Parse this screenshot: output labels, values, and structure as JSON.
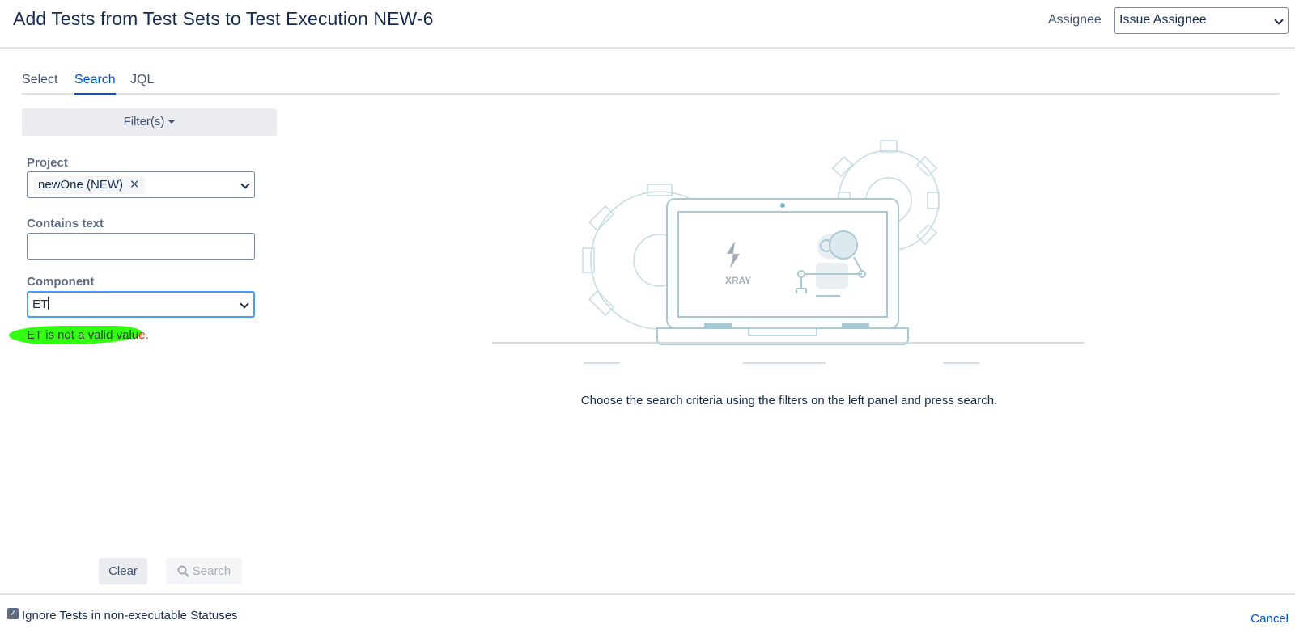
{
  "dialog": {
    "title": "Add Tests from Test Sets to Test Execution NEW-6",
    "assignee_label": "Assignee",
    "assignee_value": "Issue Assignee"
  },
  "tabs": [
    {
      "label": "Select",
      "active": false
    },
    {
      "label": "Search",
      "active": true
    },
    {
      "label": "JQL",
      "active": false
    }
  ],
  "filters": {
    "toggle_label": "Filter(s)",
    "project": {
      "label": "Project",
      "selected": "newOne (NEW)"
    },
    "contains_text": {
      "label": "Contains text",
      "value": ""
    },
    "component": {
      "label": "Component",
      "value": "ET"
    },
    "error": {
      "main": "ET is not a valid valu",
      "tail": "e."
    }
  },
  "illustration": {
    "logo_text": "XRAY"
  },
  "empty_state": {
    "message": "Choose the search criteria using the filters on the left panel and press search."
  },
  "actions": {
    "clear_label": "Clear",
    "search_label": "Search"
  },
  "footer": {
    "ignore_label": "Ignore Tests in non-executable Statuses",
    "ignore_checked": true,
    "cancel_label": "Cancel"
  },
  "colors": {
    "accent": "#0052cc",
    "error": "#de350b",
    "highlight": "#32ff12",
    "illustration_stroke": "#c4dbe3"
  }
}
